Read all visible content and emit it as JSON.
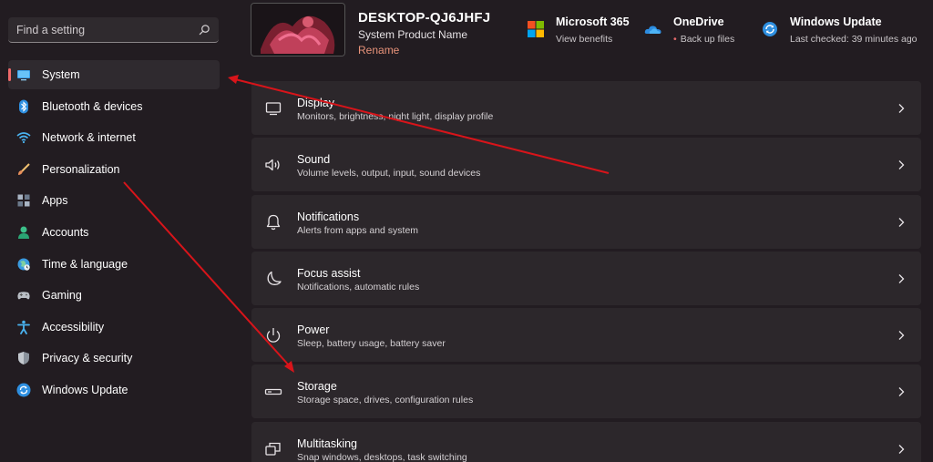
{
  "search": {
    "placeholder": "Find a setting"
  },
  "sidebar": {
    "items": [
      {
        "label": "System",
        "icon": "monitor-icon"
      },
      {
        "label": "Bluetooth & devices",
        "icon": "bluetooth-icon"
      },
      {
        "label": "Network & internet",
        "icon": "wifi-icon"
      },
      {
        "label": "Personalization",
        "icon": "brush-icon"
      },
      {
        "label": "Apps",
        "icon": "apps-icon"
      },
      {
        "label": "Accounts",
        "icon": "person-icon"
      },
      {
        "label": "Time & language",
        "icon": "globe-clock-icon"
      },
      {
        "label": "Gaming",
        "icon": "gamepad-icon"
      },
      {
        "label": "Accessibility",
        "icon": "accessibility-icon"
      },
      {
        "label": "Privacy & security",
        "icon": "shield-icon"
      },
      {
        "label": "Windows Update",
        "icon": "update-icon"
      }
    ]
  },
  "header": {
    "device_name": "DESKTOP-QJ6JHFJ",
    "device_model": "System Product Name",
    "rename_label": "Rename",
    "cards": [
      {
        "title": "Microsoft 365",
        "subtitle": "View benefits",
        "icon": "microsoft-logo-icon"
      },
      {
        "title": "OneDrive",
        "subtitle": "Back up files",
        "icon": "onedrive-cloud-icon"
      },
      {
        "title": "Windows Update",
        "subtitle": "Last checked: 39 minutes ago",
        "icon": "windows-update-icon"
      }
    ]
  },
  "settings": [
    {
      "title": "Display",
      "subtitle": "Monitors, brightness, night light, display profile",
      "icon": "display-icon"
    },
    {
      "title": "Sound",
      "subtitle": "Volume levels, output, input, sound devices",
      "icon": "speaker-icon"
    },
    {
      "title": "Notifications",
      "subtitle": "Alerts from apps and system",
      "icon": "bell-icon"
    },
    {
      "title": "Focus assist",
      "subtitle": "Notifications, automatic rules",
      "icon": "moon-icon"
    },
    {
      "title": "Power",
      "subtitle": "Sleep, battery usage, battery saver",
      "icon": "power-icon"
    },
    {
      "title": "Storage",
      "subtitle": "Storage space, drives, configuration rules",
      "icon": "storage-drive-icon"
    },
    {
      "title": "Multitasking",
      "subtitle": "Snap windows, desktops, task switching",
      "icon": "multitasking-icon"
    }
  ],
  "colors": {
    "accent": "#f06a6a",
    "rename": "#e8937a",
    "background": "#221c21",
    "card": "#2c272b",
    "arrow": "#d8141a"
  }
}
